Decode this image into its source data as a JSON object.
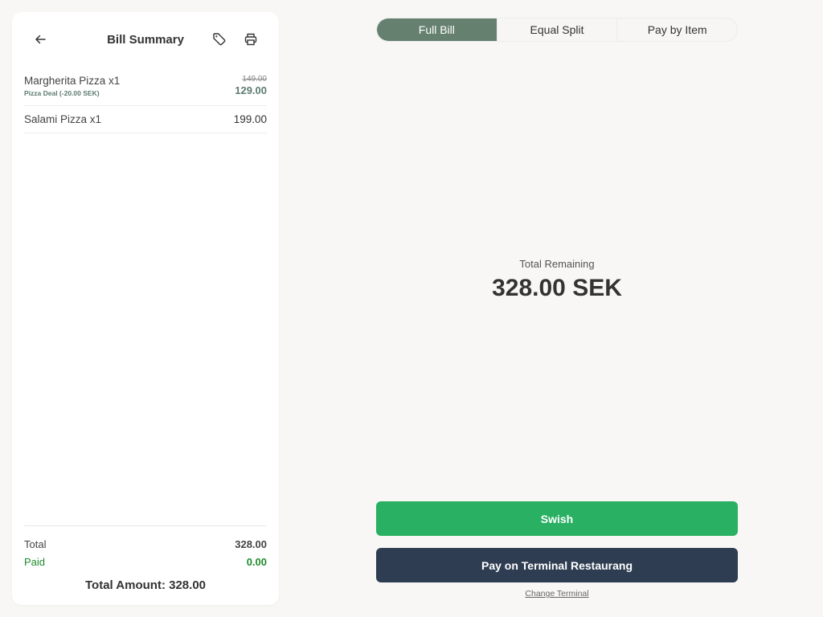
{
  "bill": {
    "title": "Bill Summary",
    "items": [
      {
        "name": "Margherita Pizza x1",
        "deal": "Pizza Deal (-20.00 SEK)",
        "original_price": "149.00",
        "price": "129.00"
      },
      {
        "name": "Salami Pizza x1",
        "price": "199.00"
      }
    ],
    "totals": {
      "total_label": "Total",
      "total_value": "328.00",
      "paid_label": "Paid",
      "paid_value": "0.00"
    },
    "total_amount": "Total Amount: 328.00"
  },
  "icons": {
    "back": "arrow-left-icon",
    "tag": "tag-icon",
    "print": "printer-icon"
  },
  "payment": {
    "tabs": [
      {
        "label": "Full Bill",
        "active": true
      },
      {
        "label": "Equal Split",
        "active": false
      },
      {
        "label": "Pay by Item",
        "active": false
      }
    ],
    "remaining_label": "Total Remaining",
    "remaining_value": "328.00 SEK",
    "swish_label": "Swish",
    "terminal_label": "Pay on Terminal Restaurang",
    "change_terminal_label": "Change Terminal"
  },
  "colors": {
    "accent": "#65806f",
    "swish": "#29b062",
    "terminal": "#2e3d52",
    "paid": "#1f8a2e"
  }
}
